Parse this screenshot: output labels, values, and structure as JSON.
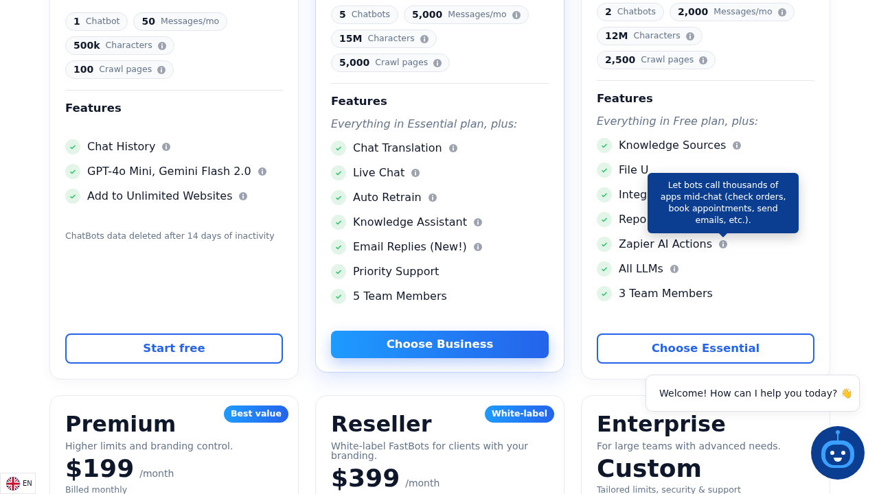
{
  "plans": [
    {
      "featured": false,
      "limits": [
        {
          "value": "1",
          "label": "Chatbot",
          "info": false
        },
        {
          "value": "50",
          "label": "Messages/mo",
          "info": false
        },
        {
          "value": "500k",
          "label": "Characters",
          "info": true
        },
        {
          "value": "100",
          "label": "Crawl pages",
          "info": true
        }
      ],
      "features_heading": "Features",
      "features": [
        {
          "text": "Chat History",
          "info": true
        },
        {
          "text": "GPT-4o Mini, Gemini Flash 2.0",
          "info": true
        },
        {
          "text": "Add to Unlimited Websites",
          "info": true
        }
      ],
      "note": "ChatBots data deleted after 14 days of inactivity",
      "button": "Start free"
    },
    {
      "featured": true,
      "limits": [
        {
          "value": "5",
          "label": "Chatbots",
          "info": false
        },
        {
          "value": "5,000",
          "label": "Messages/mo",
          "info": true
        },
        {
          "value": "15M",
          "label": "Characters",
          "info": true
        },
        {
          "value": "5,000",
          "label": "Crawl pages",
          "info": true
        }
      ],
      "features_heading": "Features",
      "features_intro": "Everything in Essential plan, plus:",
      "features": [
        {
          "text": "Chat Translation",
          "info": true
        },
        {
          "text": "Live Chat",
          "info": true
        },
        {
          "text": "Auto Retrain",
          "info": true
        },
        {
          "text": "Knowledge Assistant",
          "info": true
        },
        {
          "text": "Email Replies (New!)",
          "info": true
        },
        {
          "text": "Priority Support",
          "info": false
        },
        {
          "text": "5 Team Members",
          "info": false
        }
      ],
      "button": "Choose Business"
    },
    {
      "featured": false,
      "limits": [
        {
          "value": "2",
          "label": "Chatbots",
          "info": false
        },
        {
          "value": "2,000",
          "label": "Messages/mo",
          "info": true
        },
        {
          "value": "12M",
          "label": "Characters",
          "info": true
        },
        {
          "value": "2,500",
          "label": "Crawl pages",
          "info": true
        }
      ],
      "features_heading": "Features",
      "features_intro": "Everything in Free plan, plus:",
      "features": [
        {
          "text": "Knowledge Sources",
          "info": true
        },
        {
          "text": "File U",
          "info": false
        },
        {
          "text": "Integ",
          "info": false
        },
        {
          "text": "Repo",
          "info": false
        },
        {
          "text": "Zapier AI Actions",
          "info": true,
          "tooltip": "Let bots call thousands of apps mid-chat (check orders, book appointments, send emails, etc.)."
        },
        {
          "text": "All LLMs",
          "info": true
        },
        {
          "text": "3 Team Members",
          "info": false
        }
      ],
      "button": "Choose Essential"
    }
  ],
  "more_plans": [
    {
      "name": "Premium",
      "badge": "Best value",
      "description": "Higher limits and branding control.",
      "price": "$199",
      "period": "/month",
      "billing": "Billed monthly"
    },
    {
      "name": "Reseller",
      "badge": "White-label",
      "description": "White-label FastBots for clients with your branding.",
      "price": "$399",
      "period": "/month"
    },
    {
      "name": "Enterprise",
      "description": "For large teams with advanced needs.",
      "price": "Custom",
      "billing": "Tailored limits, security & support"
    }
  ],
  "language": {
    "code": "EN"
  },
  "chat_widget": {
    "message": "Welcome! How can I help you today? 👋"
  }
}
